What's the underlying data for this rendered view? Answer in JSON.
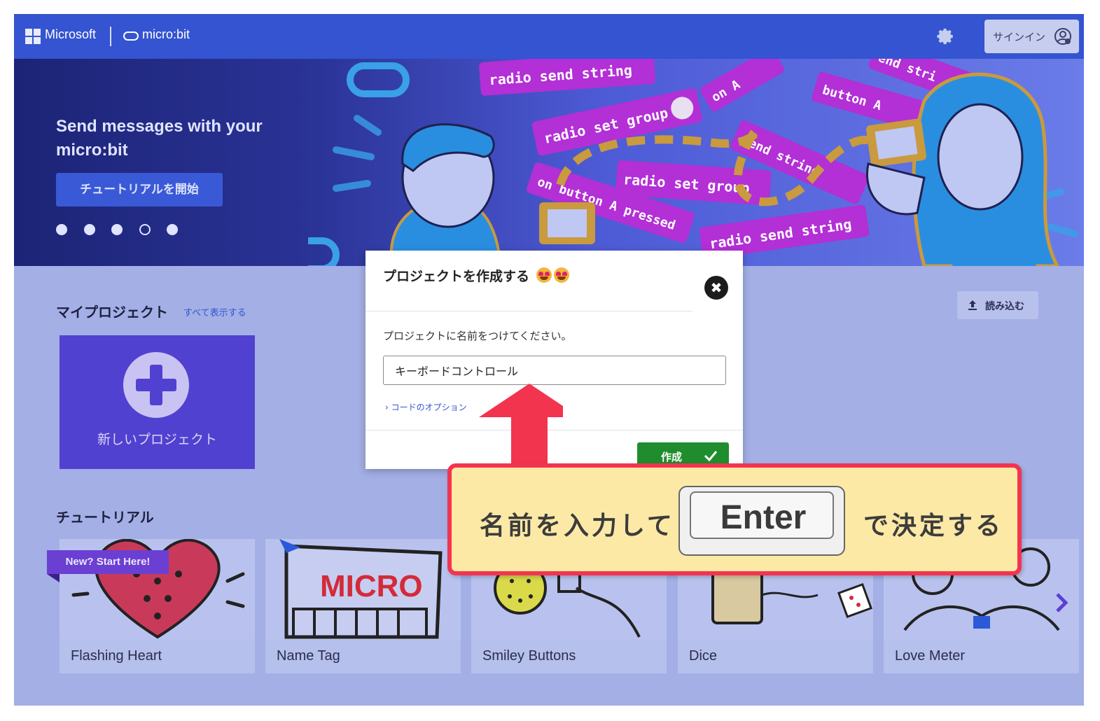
{
  "header": {
    "brand": "Microsoft",
    "product": "micro:bit",
    "settings_icon": "gear-icon",
    "signin_label": "サインイン",
    "signin_icon": "user-circle-icon"
  },
  "hero": {
    "title": "Send messages with your micro:bit",
    "button_label": "チュートリアルを開始",
    "slide_count": 5,
    "active_slide": 4,
    "art_blocks": [
      "radio send string",
      "radio set group",
      "on button A pressed",
      "radio send string",
      "radio set group",
      "button A",
      "end stri",
      "on A",
      "send string"
    ]
  },
  "projects": {
    "title": "マイプロジェクト",
    "show_all": "すべて表示する",
    "import_label": "読み込む",
    "new_project_label": "新しいプロジェクト"
  },
  "tutorials": {
    "title": "チュートリアル",
    "ribbon": "New? Start Here!",
    "cards": [
      {
        "label": "Flashing Heart"
      },
      {
        "label": "Name Tag"
      },
      {
        "label": "Smiley Buttons"
      },
      {
        "label": "Dice"
      },
      {
        "label": "Love Meter"
      }
    ],
    "thumb_text_micro": "MICRO"
  },
  "modal": {
    "title": "プロジェクトを作成する",
    "prompt": "プロジェクトに名前をつけてください。",
    "name_value": "キーボードコントロール",
    "code_options": "コードのオプション",
    "create_label": "作成",
    "close_symbol": "✖"
  },
  "annotation": {
    "left_text": "名前を入力して",
    "key_label": "Enter",
    "right_text": "で決定する",
    "accent_color": "#f2344f",
    "callout_bg": "#fde9a6"
  }
}
